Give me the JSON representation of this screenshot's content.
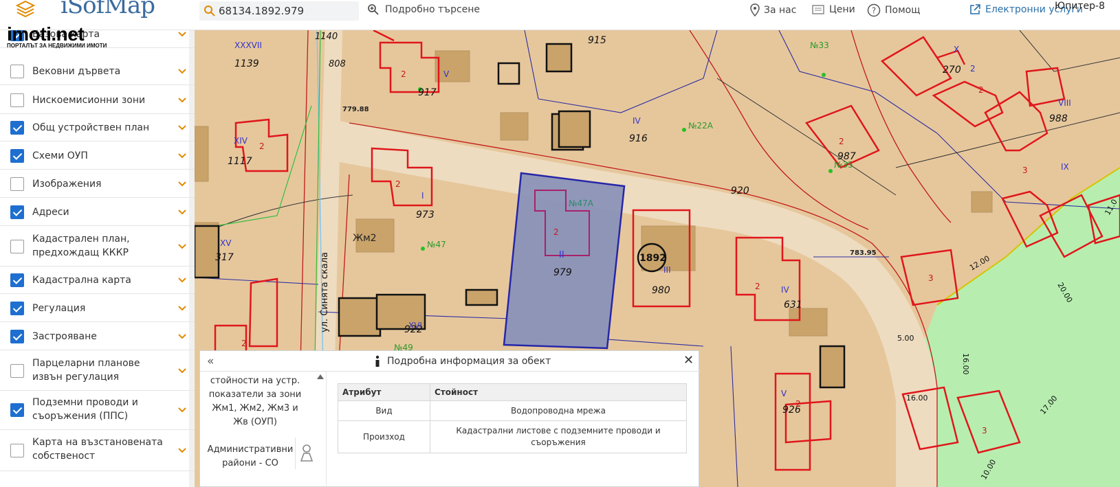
{
  "brand": {
    "logo_text": "iSofMap"
  },
  "watermark": {
    "site": "imoti.net",
    "tagline": "ПОРТАЛЪТ ЗА НЕДВИЖИМИ ИМОТИ"
  },
  "search": {
    "value": "68134.1892.979"
  },
  "header": {
    "advanced_search": "Подробно търсене",
    "about": "За нас",
    "prices": "Цени",
    "help": "Помощ",
    "electronic": "Електронни услуги",
    "user_label": "Юпитер-8"
  },
  "sidebar": {
    "layers": [
      {
        "label": "Базова карта",
        "checked": true
      },
      {
        "label": "Вековни дървета",
        "checked": false
      },
      {
        "label": "Нискоемисионни зони",
        "checked": false
      },
      {
        "label": "Общ устройствен план",
        "checked": true
      },
      {
        "label": "Схеми ОУП",
        "checked": true
      },
      {
        "label": "Изображения",
        "checked": false
      },
      {
        "label": "Адреси",
        "checked": true
      },
      {
        "label": "Кадастрален план, предхождащ КККР",
        "checked": false
      },
      {
        "label": "Кадастрална карта",
        "checked": true
      },
      {
        "label": "Регулация",
        "checked": true
      },
      {
        "label": "Застрояване",
        "checked": true
      },
      {
        "label": "Парцеларни планове извън регулация",
        "checked": false
      },
      {
        "label": "Подземни проводи и съоръжения (ППС)",
        "checked": true
      },
      {
        "label": "Карта на възстановената собственост",
        "checked": false
      }
    ]
  },
  "map": {
    "street_name": "ул. Синята скала",
    "selected_parcel": {
      "number": "979",
      "regulation": "II",
      "address": "№47А"
    },
    "parcel_numbers": [
      "1139",
      "917",
      "915",
      "270",
      "988",
      "1117",
      "916",
      "987",
      "973",
      "920",
      "980",
      "317",
      "922",
      "926",
      "631",
      "1140",
      "808"
    ],
    "zone_label": "Жм2",
    "building_number": "1892",
    "addresses": [
      "№33",
      "№35",
      "№22А",
      "№47",
      "№49"
    ],
    "elevations": [
      "779.88",
      "783.95"
    ],
    "dimensions": [
      "12.00",
      "20.00",
      "16.00",
      "16.00",
      "17.00",
      "10.00",
      "5.00",
      "11.0"
    ]
  },
  "info_panel": {
    "title": "Подробна информация за обект",
    "layer_list": [
      "стойности на устр. показатели за зони Жм1, Жм2, Жм3 и Жв (ОУП)",
      "Административни райони - СО"
    ],
    "table": {
      "headers": [
        "Атрибут",
        "Стойност"
      ],
      "rows": [
        {
          "attr": "Вид",
          "value": "Водопроводна мрежа"
        },
        {
          "attr": "Произход",
          "value": "Кадастрални листове с подземните проводи и съоръжения"
        }
      ]
    }
  },
  "colors": {
    "accent": "#1e6fcf",
    "map_parcel_fill": "#e6c79c",
    "regulation_red": "#e0161b",
    "selection_fill": "#8a92b8",
    "greenzone": "#b7eeb0"
  }
}
